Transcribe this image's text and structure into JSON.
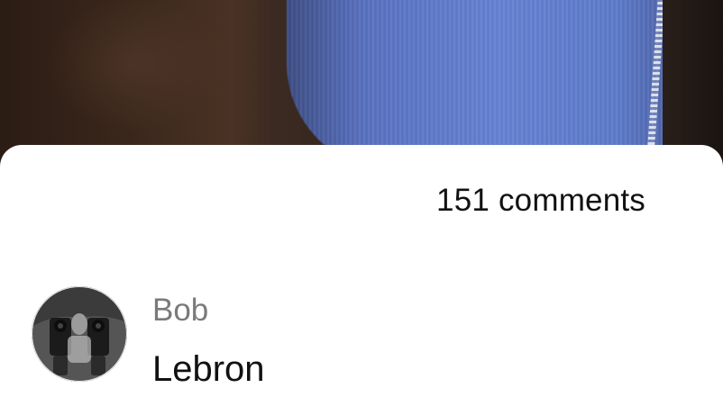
{
  "video": {
    "colors": {
      "background": "#2a1d16",
      "garment": "#6784d6"
    }
  },
  "comments_sheet": {
    "comment_count_label": "151 comments",
    "comments": [
      {
        "author": "Bob",
        "text": "Lebron",
        "avatar_icon": "avatar-photo-icon"
      }
    ]
  }
}
